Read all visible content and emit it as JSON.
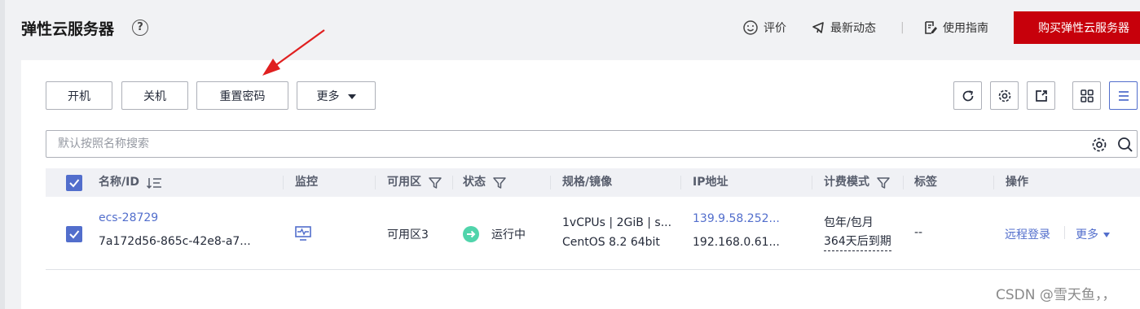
{
  "header": {
    "title": "弹性云服务器",
    "help_glyph": "?",
    "rate_label": "评价",
    "news_label": "最新动态",
    "separator": "|",
    "guide_label": "使用指南",
    "buy_label": "购买弹性云服务器"
  },
  "toolbar": {
    "start_label": "开机",
    "stop_label": "关机",
    "reset_password_label": "重置密码",
    "more_label": "更多"
  },
  "search": {
    "placeholder": "默认按照名称搜索"
  },
  "table": {
    "columns": {
      "name": "名称/ID",
      "monitor": "监控",
      "zone": "可用区",
      "status": "状态",
      "spec": "规格/镜像",
      "ip": "IP地址",
      "billing": "计费模式",
      "tags": "标签",
      "actions": "操作"
    },
    "rows": [
      {
        "name": "ecs-28729",
        "id": "7a172d56-865c-42e8-a7...",
        "zone": "可用区3",
        "status": "运行中",
        "spec": "1vCPUs | 2GiB | s...",
        "image": "CentOS 8.2 64bit",
        "public_ip": "139.9.58.252...",
        "private_ip": "192.168.0.61...",
        "billing_mode": "包年/包月",
        "expiry": "364天后到期",
        "tags": "--",
        "remote_login": "远程登录",
        "more": "更多"
      }
    ]
  },
  "colors": {
    "brand_red": "#c7000b",
    "link_blue": "#526ecc",
    "status_green": "#50d4ab",
    "annotation_arrow": "#e02020"
  },
  "watermark": "CSDN @雪天鱼，，"
}
